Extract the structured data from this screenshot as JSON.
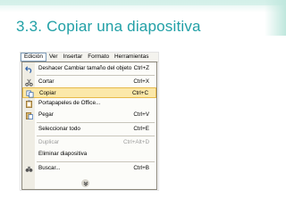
{
  "slide": {
    "title": "3.3. Copiar una diapositiva"
  },
  "menubar": {
    "items": [
      "Edición",
      "Ver",
      "Insertar",
      "Formato",
      "Herramientas"
    ]
  },
  "menu": {
    "items": [
      {
        "label": "Deshacer Cambiar tamaño del objeto",
        "shortcut": "Ctrl+Z",
        "icon": "undo-icon"
      },
      {
        "label": "Cortar",
        "shortcut": "Ctrl+X",
        "icon": "scissors-icon"
      },
      {
        "label": "Copiar",
        "shortcut": "Ctrl+C",
        "icon": "copy-icon"
      },
      {
        "label": "Portapapeles de Office...",
        "shortcut": "",
        "icon": "clipboard-icon"
      },
      {
        "label": "Pegar",
        "shortcut": "Ctrl+V",
        "icon": "paste-icon"
      },
      {
        "label": "Seleccionar todo",
        "shortcut": "Ctrl+E",
        "icon": ""
      },
      {
        "label": "Duplicar",
        "shortcut": "Ctrl+Alt+D",
        "icon": ""
      },
      {
        "label": "Eliminar diapositiva",
        "shortcut": "",
        "icon": ""
      },
      {
        "label": "Buscar...",
        "shortcut": "Ctrl+B",
        "icon": "binoculars-icon"
      }
    ],
    "expand_icon": "expand-more-icon"
  },
  "colors": {
    "title": "#21a0a6",
    "highlight": "#fbe8a9",
    "highlight_border": "#e6b94a"
  }
}
